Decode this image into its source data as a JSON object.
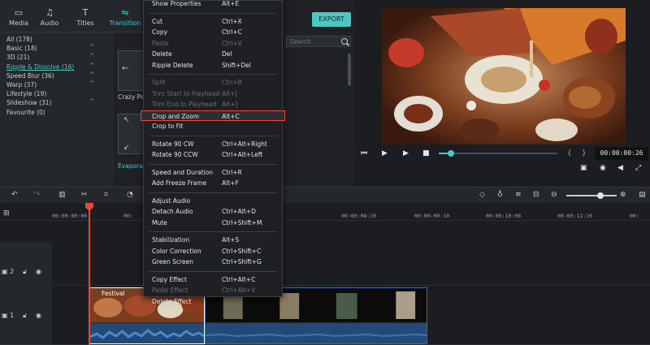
{
  "media_tabs": [
    {
      "label": "Media",
      "icon": "folder-icon"
    },
    {
      "label": "Audio",
      "icon": "music-icon"
    },
    {
      "label": "Titles",
      "icon": "text-icon"
    },
    {
      "label": "Transition",
      "icon": "transition-icon",
      "active": true
    }
  ],
  "categories": [
    {
      "label": "All (178)"
    },
    {
      "label": "Basic (18)",
      "expanded": true
    },
    {
      "label": "3D (21)",
      "expanded": true
    },
    {
      "label": "Ripple & Dissolve (16)",
      "active": true,
      "expanded": true
    },
    {
      "label": "Speed Blur (36)",
      "expanded": true
    },
    {
      "label": "Warp (37)",
      "expanded": true
    },
    {
      "label": "Lifestyle (19)"
    },
    {
      "label": "Slideshow (31)",
      "expanded": true
    },
    {
      "label": "Favourite (0)"
    }
  ],
  "grid_labels": {
    "first": "Crazy Pa",
    "second": "Evapora"
  },
  "toolbar": {
    "export_label": "EXPORT"
  },
  "search": {
    "placeholder": "Search"
  },
  "preview": {
    "timecode": "00:00:00:26",
    "progress_fraction": 0.1
  },
  "timeline": {
    "ruler_labels": [
      "00:00:00:00",
      "00:",
      "00:00:08:20",
      "00:00:00:10",
      "00:00:10:00",
      "00:00:11:20",
      "00:"
    ],
    "tracks": [
      {
        "name": "2"
      },
      {
        "name": "1"
      }
    ],
    "zoom_fraction": 0.68,
    "festival_clip_label": "Festival"
  },
  "context_menu": {
    "items": [
      {
        "label": "Show Properties",
        "shortcut": "Alt+E",
        "disabled": false
      },
      {
        "sep": true
      },
      {
        "label": "Cut",
        "shortcut": "Ctrl+X",
        "disabled": false
      },
      {
        "label": "Copy",
        "shortcut": "Ctrl+C",
        "disabled": false
      },
      {
        "label": "Paste",
        "shortcut": "Ctrl+V",
        "disabled": true
      },
      {
        "label": "Delete",
        "shortcut": "Del",
        "disabled": false
      },
      {
        "label": "Ripple Delete",
        "shortcut": "Shift+Del",
        "disabled": false
      },
      {
        "sep": true
      },
      {
        "label": "Split",
        "shortcut": "Ctrl+B",
        "disabled": true
      },
      {
        "label": "Trim Start to Playhead",
        "shortcut": "Alt+[",
        "disabled": true
      },
      {
        "label": "Trim End to Playhead",
        "shortcut": "Alt+]",
        "disabled": true
      },
      {
        "label": "Crop and Zoom",
        "shortcut": "Alt+C",
        "disabled": false,
        "highlighted": true
      },
      {
        "label": "Crop to Fit",
        "shortcut": "",
        "disabled": false
      },
      {
        "sep": true
      },
      {
        "label": "Rotate 90 CW",
        "shortcut": "Ctrl+Alt+Right",
        "disabled": false
      },
      {
        "label": "Rotate 90 CCW",
        "shortcut": "Ctrl+Alt+Left",
        "disabled": false
      },
      {
        "sep": true
      },
      {
        "label": "Speed and Duration",
        "shortcut": "Ctrl+R",
        "disabled": false
      },
      {
        "label": "Add Freeze Frame",
        "shortcut": "Alt+F",
        "disabled": false
      },
      {
        "sep": true
      },
      {
        "label": "Adjust Audio",
        "shortcut": "",
        "disabled": false
      },
      {
        "label": "Detach Audio",
        "shortcut": "Ctrl+Alt+D",
        "disabled": false
      },
      {
        "label": "Mute",
        "shortcut": "Ctrl+Shift+M",
        "disabled": false
      },
      {
        "sep": true
      },
      {
        "label": "Stabilization",
        "shortcut": "Alt+S",
        "disabled": false
      },
      {
        "label": "Color Correction",
        "shortcut": "Ctrl+Shift+C",
        "disabled": false
      },
      {
        "label": "Green Screen",
        "shortcut": "Ctrl+Shift+G",
        "disabled": false
      },
      {
        "sep": true
      },
      {
        "label": "Copy Effect",
        "shortcut": "Ctrl+Alt+C",
        "disabled": false
      },
      {
        "label": "Paste Effect",
        "shortcut": "Ctrl+Alt+V",
        "disabled": true
      },
      {
        "label": "Delete Effect",
        "shortcut": "",
        "disabled": false
      }
    ]
  },
  "colors": {
    "accent": "#4ec7c1",
    "playhead": "#e8473b",
    "highlight_border": "#e8473b"
  }
}
